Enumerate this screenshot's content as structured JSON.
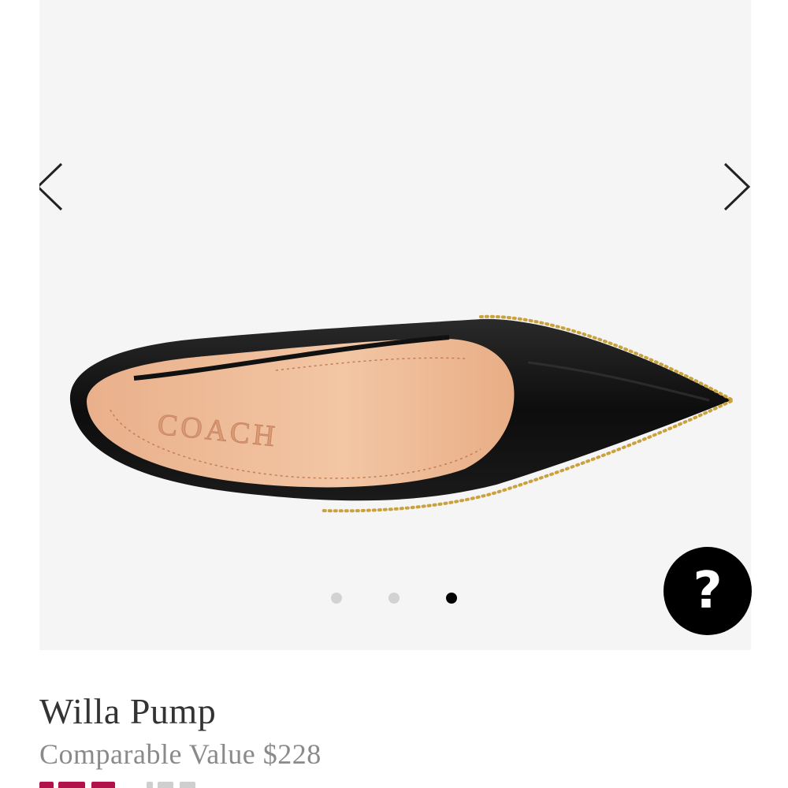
{
  "product": {
    "name": "Willa Pump",
    "comparable_label": "Comparable Value",
    "comparable_price": "$228",
    "brand_emboss": "COACH"
  },
  "gallery": {
    "total_images": 3,
    "active_index": 3,
    "prev_icon": "chevron-left-icon",
    "next_icon": "chevron-right-icon"
  },
  "help": {
    "icon": "question-mark-icon",
    "symbol": "?"
  },
  "colors": {
    "sale_accent": "#b1124a",
    "dot_active": "#000000",
    "dot_inactive": "#d2d2d2"
  }
}
